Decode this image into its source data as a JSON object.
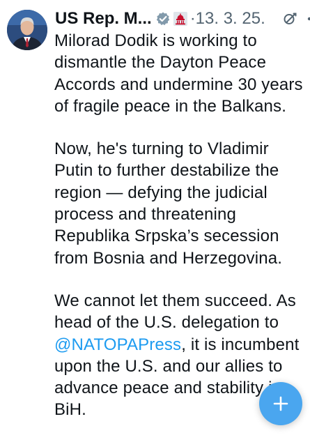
{
  "post": {
    "author_name": "US Rep. M...",
    "date": "·13. 3. 25.",
    "icons": {
      "avatar": "profile-photo",
      "verified": "verified-badge-icon",
      "affiliation": "capitol-dome-icon",
      "grok": "grok-icon",
      "more": "more-options-icon"
    },
    "paragraphs": {
      "p1": "Milorad Dodik is working to dismantle the Dayton Peace Accords and undermine 30 years of fragile peace in the Balkans.",
      "p2": "Now, he's turning to Vladimir Putin to further destabilize the region — defying the judicial process and threatening Republika Srpska’s secession from Bosnia and Herzegovina.",
      "p3_before": "We cannot let them succeed. As head of the U.S. delegation to ",
      "p3_mention": "@NATOPAPress",
      "p3_after": ", it is incumbent upon the U.S. and our allies to advance peace and stability in BiH."
    }
  },
  "compose_button": {
    "icon": "plus-icon"
  },
  "colors": {
    "text": "#0f1419",
    "muted": "#536471",
    "link": "#1d9bf0",
    "fab": "#4aa6ef"
  }
}
